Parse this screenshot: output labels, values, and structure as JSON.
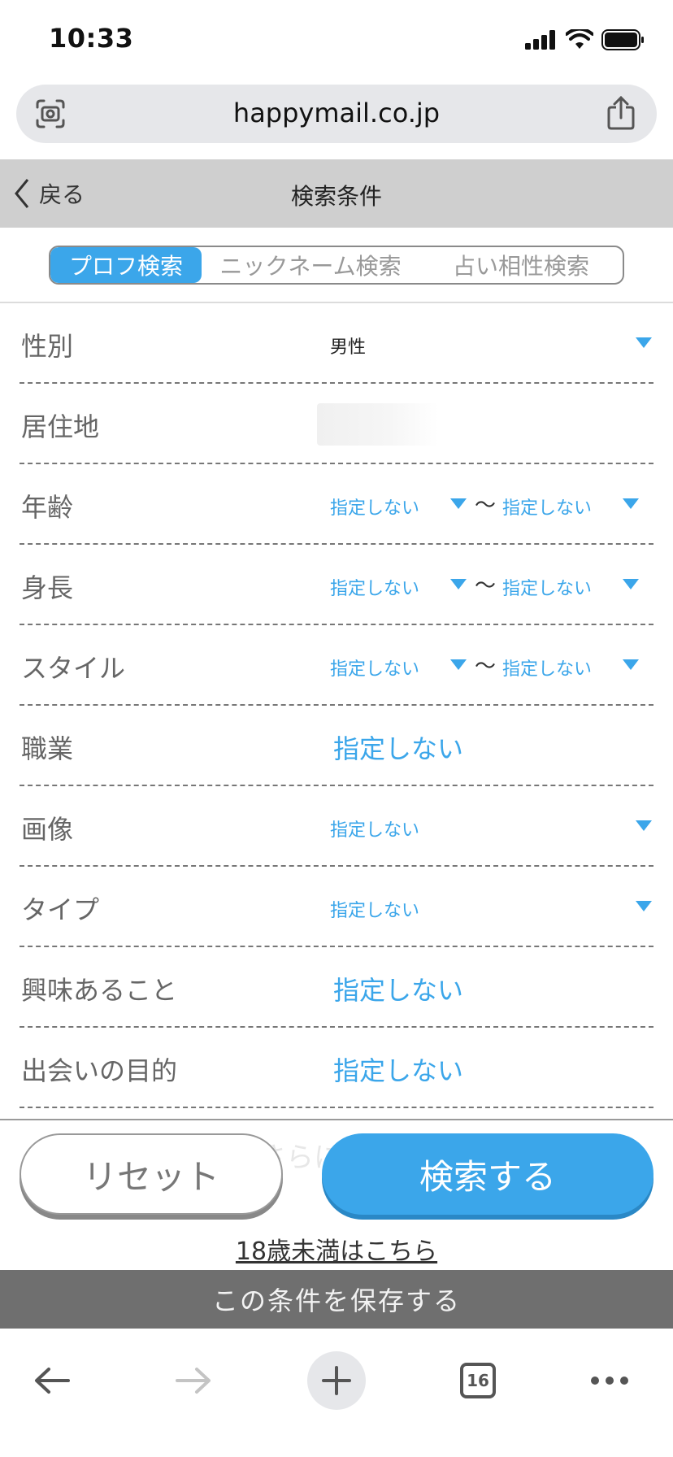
{
  "status_bar": {
    "time": "10:33"
  },
  "browser": {
    "url": "happymail.co.jp",
    "tab_count": "16"
  },
  "header": {
    "back_label": "戻る",
    "title": "検索条件"
  },
  "tabs": [
    {
      "label": "プロフ検索",
      "active": true
    },
    {
      "label": "ニックネーム検索",
      "active": false
    },
    {
      "label": "占い相性検索",
      "active": false
    }
  ],
  "fields": {
    "gender": {
      "label": "性別",
      "value": "男性"
    },
    "residence": {
      "label": "居住地"
    },
    "age": {
      "label": "年齢",
      "from": "指定しない",
      "tilde": "〜",
      "to": "指定しない"
    },
    "height": {
      "label": "身長",
      "from": "指定しない",
      "tilde": "〜",
      "to": "指定しない"
    },
    "style": {
      "label": "スタイル",
      "from": "指定しない",
      "tilde": "〜",
      "to": "指定しない"
    },
    "occupation": {
      "label": "職業",
      "value": "指定しない"
    },
    "image": {
      "label": "画像",
      "value": "指定しない"
    },
    "type": {
      "label": "タイプ",
      "value": "指定しない"
    },
    "interests": {
      "label": "興味あること",
      "value": "指定しない"
    },
    "purpose": {
      "label": "出会いの目的",
      "value": "指定しない"
    }
  },
  "more_conditions": "さらにこだわる",
  "buttons": {
    "reset": "リセット",
    "search": "検索する"
  },
  "under18_link": "18歳未満はこちら",
  "save_bar": "この条件を保存する",
  "colors": {
    "accent": "#3ba6ea",
    "header_bg": "#cfcfcf",
    "save_bar_bg": "#6f6f6f"
  }
}
